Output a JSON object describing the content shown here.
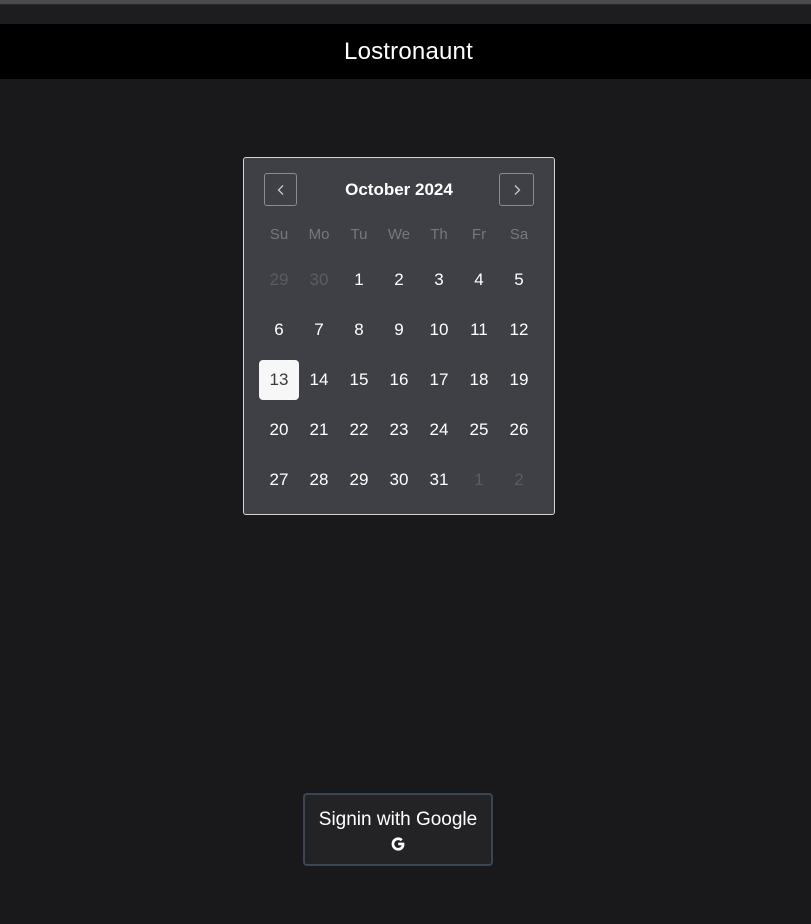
{
  "header": {
    "title": "Lostronaunt"
  },
  "calendar": {
    "month_label": "October 2024",
    "prev_icon": "chevron-left-icon",
    "next_icon": "chevron-right-icon",
    "weekdays": [
      "Su",
      "Mo",
      "Tu",
      "We",
      "Th",
      "Fr",
      "Sa"
    ],
    "weeks": [
      [
        {
          "d": "29",
          "outside": true
        },
        {
          "d": "30",
          "outside": true
        },
        {
          "d": "1"
        },
        {
          "d": "2"
        },
        {
          "d": "3"
        },
        {
          "d": "4"
        },
        {
          "d": "5"
        }
      ],
      [
        {
          "d": "6"
        },
        {
          "d": "7"
        },
        {
          "d": "8"
        },
        {
          "d": "9"
        },
        {
          "d": "10"
        },
        {
          "d": "11"
        },
        {
          "d": "12"
        }
      ],
      [
        {
          "d": "13",
          "today": true
        },
        {
          "d": "14"
        },
        {
          "d": "15"
        },
        {
          "d": "16"
        },
        {
          "d": "17"
        },
        {
          "d": "18"
        },
        {
          "d": "19"
        }
      ],
      [
        {
          "d": "20"
        },
        {
          "d": "21"
        },
        {
          "d": "22"
        },
        {
          "d": "23"
        },
        {
          "d": "24"
        },
        {
          "d": "25"
        },
        {
          "d": "26"
        }
      ],
      [
        {
          "d": "27"
        },
        {
          "d": "28"
        },
        {
          "d": "29"
        },
        {
          "d": "30"
        },
        {
          "d": "31"
        },
        {
          "d": "1",
          "outside": true
        },
        {
          "d": "2",
          "outside": true
        }
      ]
    ]
  },
  "signin": {
    "label": "Signin with Google",
    "icon": "google-icon"
  },
  "colors": {
    "background": "#19191b",
    "header_bg": "#000000",
    "calendar_bg": "#3f4045",
    "today_bg": "#f7f7f7",
    "button_border": "#3a4556"
  }
}
